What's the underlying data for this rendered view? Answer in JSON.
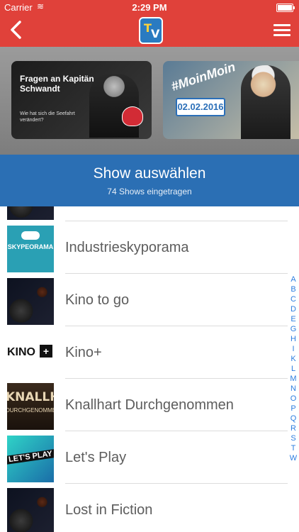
{
  "status": {
    "carrier": "Carrier",
    "time": "2:29 PM"
  },
  "nav": {
    "back_icon": "chevron-left-icon",
    "menu_icon": "hamburger-menu-icon",
    "logo": "TV"
  },
  "carousel": {
    "cards": [
      {
        "title": "Fragen an Kapitän Schwandt",
        "subtitle": "Wie hat sich die Seefahrt verändert?"
      },
      {
        "tag": "#MoinMoin",
        "date": "02.02.2016"
      }
    ]
  },
  "header": {
    "title": "Show auswählen",
    "subtitle": "74 Shows eingetragen"
  },
  "shows": [
    {
      "name": ""
    },
    {
      "name": "Industrieskyporama",
      "thumb_text": "SKYPEORAMA"
    },
    {
      "name": "Kino to go"
    },
    {
      "name": "Kino+",
      "thumb_text": "KINO"
    },
    {
      "name": "Knallhart Durchgenommen",
      "thumb_text": "KNALLHAR",
      "thumb_text2": "DURCHGENOMMEN"
    },
    {
      "name": "Let's Play",
      "thumb_text": "LET'S PLAY"
    },
    {
      "name": "Lost in Fiction"
    }
  ],
  "index_letters": [
    "A",
    "B",
    "C",
    "D",
    "E",
    "G",
    "H",
    "I",
    "K",
    "L",
    "M",
    "N",
    "O",
    "P",
    "Q",
    "R",
    "S",
    "T",
    "W"
  ],
  "colors": {
    "nav": "#e0413a",
    "header": "#2b6fb4",
    "index": "#2b7de0"
  }
}
